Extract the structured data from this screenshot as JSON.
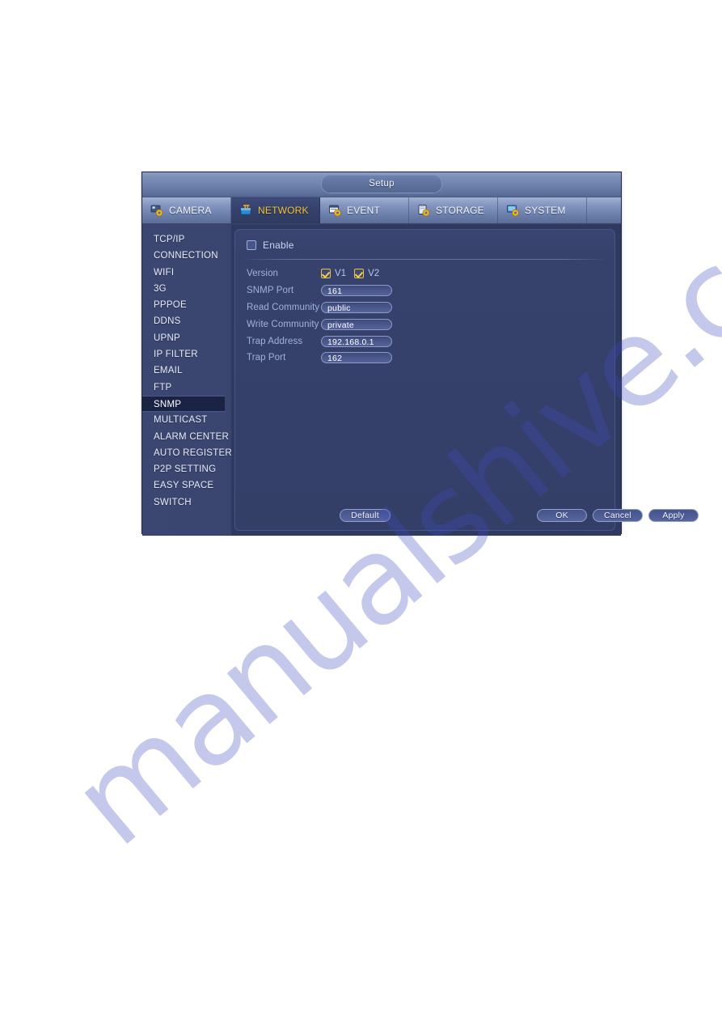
{
  "window": {
    "title": "Setup"
  },
  "tabs": [
    {
      "label": "CAMERA",
      "icon": "camera-gear-icon",
      "active": false
    },
    {
      "label": "NETWORK",
      "icon": "network-icon",
      "active": true
    },
    {
      "label": "EVENT",
      "icon": "event-gear-icon",
      "active": false
    },
    {
      "label": "STORAGE",
      "icon": "storage-gear-icon",
      "active": false
    },
    {
      "label": "SYSTEM",
      "icon": "system-gear-icon",
      "active": false
    }
  ],
  "sidebar": {
    "items": [
      {
        "label": "TCP/IP",
        "selected": false
      },
      {
        "label": "CONNECTION",
        "selected": false
      },
      {
        "label": "WIFI",
        "selected": false
      },
      {
        "label": "3G",
        "selected": false
      },
      {
        "label": "PPPOE",
        "selected": false
      },
      {
        "label": "DDNS",
        "selected": false
      },
      {
        "label": "UPNP",
        "selected": false
      },
      {
        "label": "IP FILTER",
        "selected": false
      },
      {
        "label": "EMAIL",
        "selected": false
      },
      {
        "label": "FTP",
        "selected": false
      },
      {
        "label": "SNMP",
        "selected": true
      },
      {
        "label": "MULTICAST",
        "selected": false
      },
      {
        "label": "ALARM CENTER",
        "selected": false
      },
      {
        "label": "AUTO REGISTER",
        "selected": false
      },
      {
        "label": "P2P SETTING",
        "selected": false
      },
      {
        "label": "EASY SPACE",
        "selected": false
      },
      {
        "label": "SWITCH",
        "selected": false
      }
    ]
  },
  "form": {
    "enable": {
      "label": "Enable",
      "checked": false
    },
    "version": {
      "label": "Version",
      "options": [
        {
          "label": "V1",
          "checked": true
        },
        {
          "label": "V2",
          "checked": true
        }
      ]
    },
    "fields": [
      {
        "label": "SNMP Port",
        "value": "161"
      },
      {
        "label": "Read Community",
        "value": "public"
      },
      {
        "label": "Write Community",
        "value": "private"
      },
      {
        "label": "Trap Address",
        "value": "192.168.0.1"
      },
      {
        "label": "Trap Port",
        "value": "162"
      }
    ]
  },
  "footer": {
    "default_label": "Default",
    "ok_label": "OK",
    "cancel_label": "Cancel",
    "apply_label": "Apply"
  },
  "watermark": {
    "text": "manualshive.com"
  },
  "colors": {
    "window_bg": "#2f3a60",
    "panel_bg": "#36426c",
    "sidebar_bg": "#3a4670",
    "selected_item_bg": "#1b2345",
    "active_tab_text": "#f3c33a",
    "label_text": "#9fb2de",
    "checkbox_accent": "#e9c43c",
    "watermark": "#3f4bbf"
  }
}
